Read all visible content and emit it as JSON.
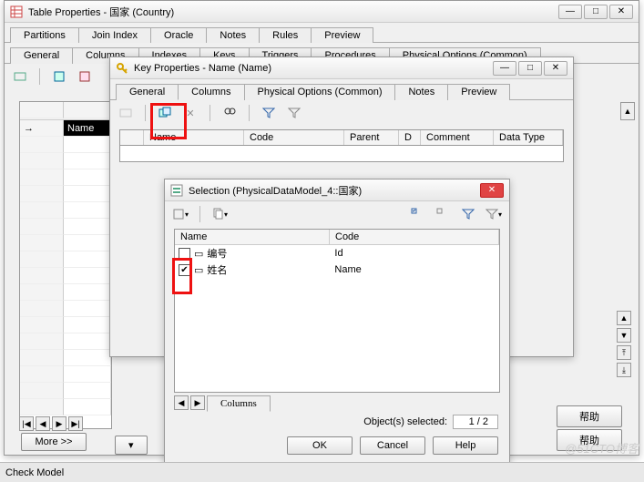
{
  "watermark": "@51CTO博客",
  "window1": {
    "title": "Table Properties - 国家 (Country)",
    "tabsRow1": [
      "Partitions",
      "Join Index",
      "Oracle",
      "Notes",
      "Rules",
      "Preview"
    ],
    "tabsRow2": [
      "General",
      "Columns",
      "Indexes",
      "Keys",
      "Triggers",
      "Procedures",
      "Physical Options (Common)"
    ],
    "gridRow1": "Name",
    "moreBtn": "More >>",
    "helpBtn": "帮助",
    "helpBtn2": "帮助"
  },
  "window2": {
    "title": "Key Properties - Name (Name)",
    "tabs": [
      "General",
      "Columns",
      "Physical Options (Common)",
      "Notes",
      "Preview"
    ],
    "activeTab": "Columns",
    "headers": [
      "",
      "Name",
      "Code",
      "Parent",
      "D",
      "Comment",
      "Data Type"
    ]
  },
  "window3": {
    "title": "Selection (PhysicalDataModel_4::国家)",
    "headers": [
      "Name",
      "Code"
    ],
    "rows": [
      {
        "checked": false,
        "name": "编号",
        "code": "Id"
      },
      {
        "checked": true,
        "name": "姓名",
        "code": "Name"
      }
    ],
    "tabLabel": "Columns",
    "statusLabel": "Object(s) selected:",
    "statusCount": "1 / 2",
    "okBtn": "OK",
    "cancelBtn": "Cancel",
    "helpBtn": "Help"
  },
  "statusbar": {
    "label": "Check Model"
  }
}
